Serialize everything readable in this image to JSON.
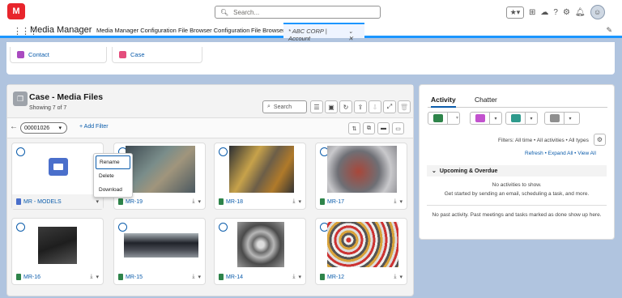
{
  "header": {
    "logo_text": "M",
    "search_placeholder": "Search..."
  },
  "nav": {
    "app_name": "Media Manager",
    "items": [
      "Media Manager Configuration",
      "File Browser Configuration",
      "File Browser"
    ],
    "active_tab": "* ABC CORP | Account"
  },
  "related": {
    "contact": "Contact",
    "case": "Case"
  },
  "card": {
    "title": "Case - Media Files",
    "subtitle": "Showing 7 of 7",
    "search_placeholder": "Search",
    "record_id": "00001026",
    "add_filter": "+ Add Filter"
  },
  "files": [
    {
      "name": "MR - MODELS",
      "type": "folder"
    },
    {
      "name": "MR-19",
      "type": "image"
    },
    {
      "name": "MR-18",
      "type": "image"
    },
    {
      "name": "MR-17",
      "type": "image"
    },
    {
      "name": "MR-16",
      "type": "image"
    },
    {
      "name": "MR-15",
      "type": "image"
    },
    {
      "name": "MR-14",
      "type": "image"
    },
    {
      "name": "MR-12",
      "type": "image"
    }
  ],
  "context_menu": [
    "Rename",
    "Delete",
    "Download"
  ],
  "activity": {
    "tabs": [
      "Activity",
      "Chatter"
    ],
    "filters": "Filters: All time • All activities • All types",
    "links": [
      "Refresh",
      "Expand All",
      "View All"
    ],
    "upcoming_title": "Upcoming & Overdue",
    "no_activities": "No activities to show.",
    "get_started": "Get started by sending an email, scheduling a task, and more.",
    "no_past": "No past activity. Past meetings and tasks marked as done show up here.",
    "quick_action_colors": [
      "#2e844a",
      "#c252ce",
      "#2e9a8c",
      "#8f8f8f"
    ]
  }
}
